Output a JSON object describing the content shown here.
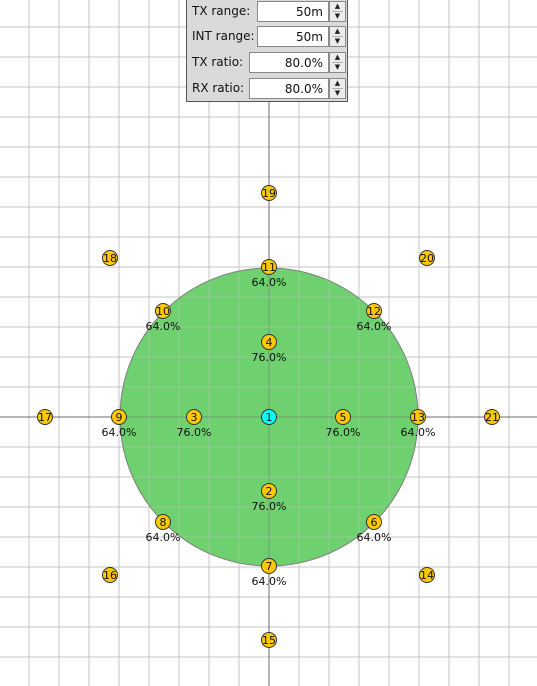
{
  "panel": {
    "rows": [
      {
        "label": "TX range:",
        "value": "50m"
      },
      {
        "label": "INT range:",
        "value": "50m"
      },
      {
        "label": "TX ratio:",
        "value": "80.0%"
      },
      {
        "label": "RX ratio:",
        "value": "80.0%"
      }
    ],
    "up_icon": "up-arrow-icon",
    "down_icon": "down-arrow-icon"
  },
  "colors": {
    "background": "#ffffff",
    "grid": "#c4c4c4",
    "axis": "#6d6d6d",
    "range_fill": "#6bcf6b",
    "range_stroke": "#808080",
    "node": "#ffc800",
    "selected_node": "#00ffff",
    "node_stroke": "#333333"
  },
  "nodes": [
    {
      "id": "1",
      "selected": true,
      "percent": ""
    },
    {
      "id": "2",
      "selected": false,
      "percent": "76.0%"
    },
    {
      "id": "3",
      "selected": false,
      "percent": "76.0%"
    },
    {
      "id": "4",
      "selected": false,
      "percent": "76.0%"
    },
    {
      "id": "5",
      "selected": false,
      "percent": "76.0%"
    },
    {
      "id": "6",
      "selected": false,
      "percent": "64.0%"
    },
    {
      "id": "7",
      "selected": false,
      "percent": "64.0%"
    },
    {
      "id": "8",
      "selected": false,
      "percent": "64.0%"
    },
    {
      "id": "9",
      "selected": false,
      "percent": "64.0%"
    },
    {
      "id": "10",
      "selected": false,
      "percent": "64.0%"
    },
    {
      "id": "11",
      "selected": false,
      "percent": "64.0%"
    },
    {
      "id": "12",
      "selected": false,
      "percent": "64.0%"
    },
    {
      "id": "13",
      "selected": false,
      "percent": "64.0%"
    },
    {
      "id": "14",
      "selected": false,
      "percent": ""
    },
    {
      "id": "15",
      "selected": false,
      "percent": ""
    },
    {
      "id": "16",
      "selected": false,
      "percent": ""
    },
    {
      "id": "17",
      "selected": false,
      "percent": ""
    },
    {
      "id": "18",
      "selected": false,
      "percent": ""
    },
    {
      "id": "19",
      "selected": false,
      "percent": ""
    },
    {
      "id": "20",
      "selected": false,
      "percent": ""
    },
    {
      "id": "21",
      "selected": false,
      "percent": ""
    }
  ]
}
